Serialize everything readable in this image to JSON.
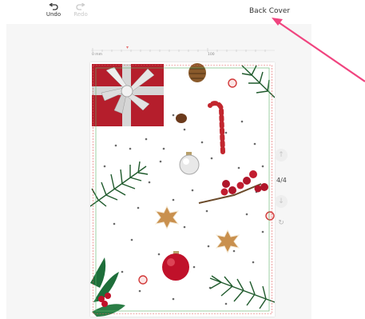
{
  "toolbar": {
    "undo_label": "Undo",
    "redo_label": "Redo",
    "page_label": "Back Cover"
  },
  "ruler": {
    "start_label": "0 mm",
    "mid_label": "100"
  },
  "pager": {
    "counter": "4/4"
  },
  "colors": {
    "annotation_arrow": "#f0447f",
    "gift_red": "#b51e2c",
    "bleed_line_red": "#e05a5a",
    "safe_line_green": "#5cb46a"
  },
  "icons": {
    "undo": "undo-icon",
    "redo": "redo-icon",
    "page_up": "arrow-up-icon",
    "page_down": "arrow-down-icon",
    "rotate": "rotate-icon"
  }
}
